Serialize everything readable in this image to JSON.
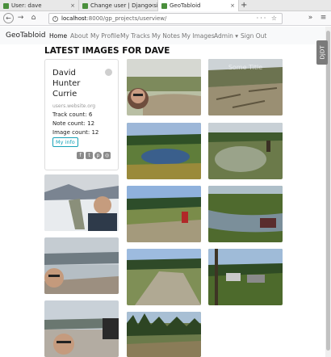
{
  "browser": {
    "tabs": [
      {
        "title": "User: dave",
        "favicon_color": "#4a8f3c"
      },
      {
        "title": "Change user | Django site a",
        "favicon_color": "#4a8f3c"
      },
      {
        "title": "GeoTabloid",
        "favicon_color": "#4a8f3c"
      }
    ],
    "close_glyph": "×",
    "new_tab_glyph": "+",
    "url": {
      "host": "localhost",
      "rest": ":8000/gp_projects/userview/"
    },
    "nav_icons": [
      "back-icon",
      "forward-icon",
      "home-icon",
      "site-info-icon",
      "more-icon",
      "bookmark-icon",
      "menu-icon"
    ]
  },
  "site": {
    "brand": "GeoTabloid",
    "nav": [
      "Home",
      "About",
      "My Profile",
      "My Tracks",
      "My Notes",
      "My Images",
      "Admin ▾",
      "Sign Out"
    ],
    "side_tab": "DjDT"
  },
  "page": {
    "title": "LATEST IMAGES FOR DAVE",
    "profile": {
      "name": "David Hunter Currie",
      "website": "users.website.org",
      "track_count": "Track count: 6",
      "note_count": "Note count: 12",
      "image_count": "Image count: 12",
      "button": "My info",
      "social_icons": [
        "facebook-icon",
        "twitter-icon",
        "pinterest-icon",
        "instagram-icon"
      ],
      "social_glyphs": [
        "f",
        "t",
        "p",
        "◎"
      ]
    },
    "watermark": "Some Title",
    "images": [
      {
        "name": "selfie-riverbank"
      },
      {
        "name": "logged-slope"
      },
      {
        "name": "man-holding-fish"
      },
      {
        "name": "mountain-pond"
      },
      {
        "name": "muddy-puddle-trail"
      },
      {
        "name": "selfie-lake-shore"
      },
      {
        "name": "atv-meadow"
      },
      {
        "name": "atv-creek"
      },
      {
        "name": "gravel-pit"
      },
      {
        "name": "forest-clearing-trucks"
      },
      {
        "name": "selfie-truck-gravel"
      },
      {
        "name": "clearcut-forest"
      }
    ]
  }
}
